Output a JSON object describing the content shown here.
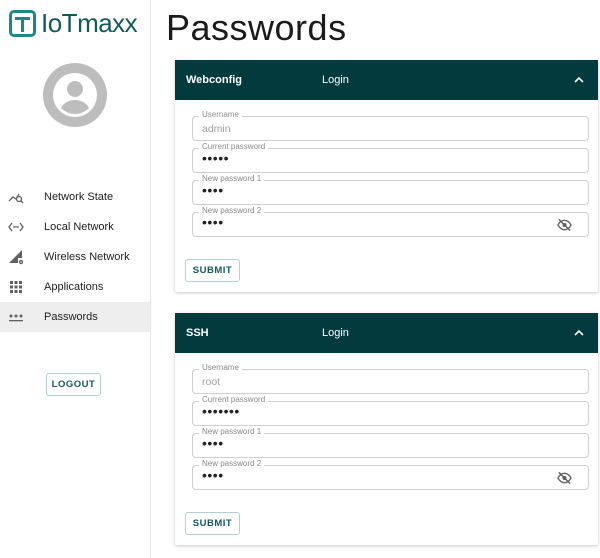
{
  "brand": {
    "name": "IoTmaxx",
    "color": "#14595a"
  },
  "sidebar": {
    "items": [
      {
        "label": "Network State",
        "icon": "network-state-icon"
      },
      {
        "label": "Local Network",
        "icon": "local-network-icon"
      },
      {
        "label": "Wireless Network",
        "icon": "wireless-network-icon"
      },
      {
        "label": "Applications",
        "icon": "apps-grid-icon"
      },
      {
        "label": "Passwords",
        "icon": "password-dots-icon",
        "active": true
      }
    ],
    "logout_label": "LOGOUT"
  },
  "main": {
    "title": "Passwords",
    "cards": [
      {
        "title": "Webconfig",
        "subtitle": "Login",
        "fields": [
          {
            "label": "Username",
            "value": "admin"
          },
          {
            "label": "Current password",
            "value": "•••••"
          },
          {
            "label": "New password 1",
            "value": "••••"
          },
          {
            "label": "New password 2",
            "value": "••••"
          }
        ],
        "submit_label": "SUBMIT"
      },
      {
        "title": "SSH",
        "subtitle": "Login",
        "fields": [
          {
            "label": "Username",
            "value": "root"
          },
          {
            "label": "Current password",
            "value": "•••••••"
          },
          {
            "label": "New password 1",
            "value": "••••"
          },
          {
            "label": "New password 2",
            "value": "••••"
          }
        ],
        "submit_label": "SUBMIT"
      }
    ]
  },
  "colors": {
    "accent": "#023a3e",
    "active_bg": "#eeeeee",
    "border": "#cfcfcf"
  }
}
